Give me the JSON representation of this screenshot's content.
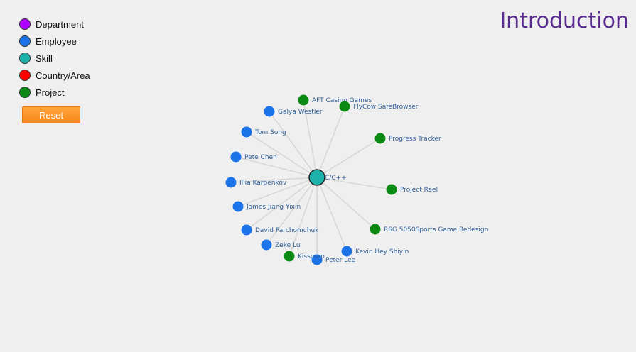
{
  "page": {
    "title": "Introduction"
  },
  "legend": [
    {
      "label": "Department",
      "color": "#b000ff"
    },
    {
      "label": "Employee",
      "color": "#1a73e8"
    },
    {
      "label": "Skill",
      "color": "#1fb2aa"
    },
    {
      "label": "Country/Area",
      "color": "#ff0000"
    },
    {
      "label": "Project",
      "color": "#0a8a12"
    }
  ],
  "reset_label": "Reset",
  "graph": {
    "center": {
      "label": "C/C++",
      "type": "Skill"
    },
    "nodes": [
      {
        "label": "AFT Casino Games",
        "type": "Project"
      },
      {
        "label": "FlyCow SafeBrowser",
        "type": "Project"
      },
      {
        "label": "Progress Tracker",
        "type": "Project"
      },
      {
        "label": "Project Reel",
        "type": "Project"
      },
      {
        "label": "RSG 5050Sports Game Redesign",
        "type": "Project"
      },
      {
        "label": "Kevin Hey Shiyin",
        "type": "Employee"
      },
      {
        "label": "Peter Lee",
        "type": "Employee"
      },
      {
        "label": "Kissmap",
        "type": "Project"
      },
      {
        "label": "Zeke Lu",
        "type": "Employee"
      },
      {
        "label": "David Parchomchuk",
        "type": "Employee"
      },
      {
        "label": "James Jiang Yixin",
        "type": "Employee"
      },
      {
        "label": "Illia Karpenkov",
        "type": "Employee"
      },
      {
        "label": "Pete Chen",
        "type": "Employee"
      },
      {
        "label": "Tom Song",
        "type": "Employee"
      },
      {
        "label": "Galya Westler",
        "type": "Employee"
      }
    ]
  }
}
